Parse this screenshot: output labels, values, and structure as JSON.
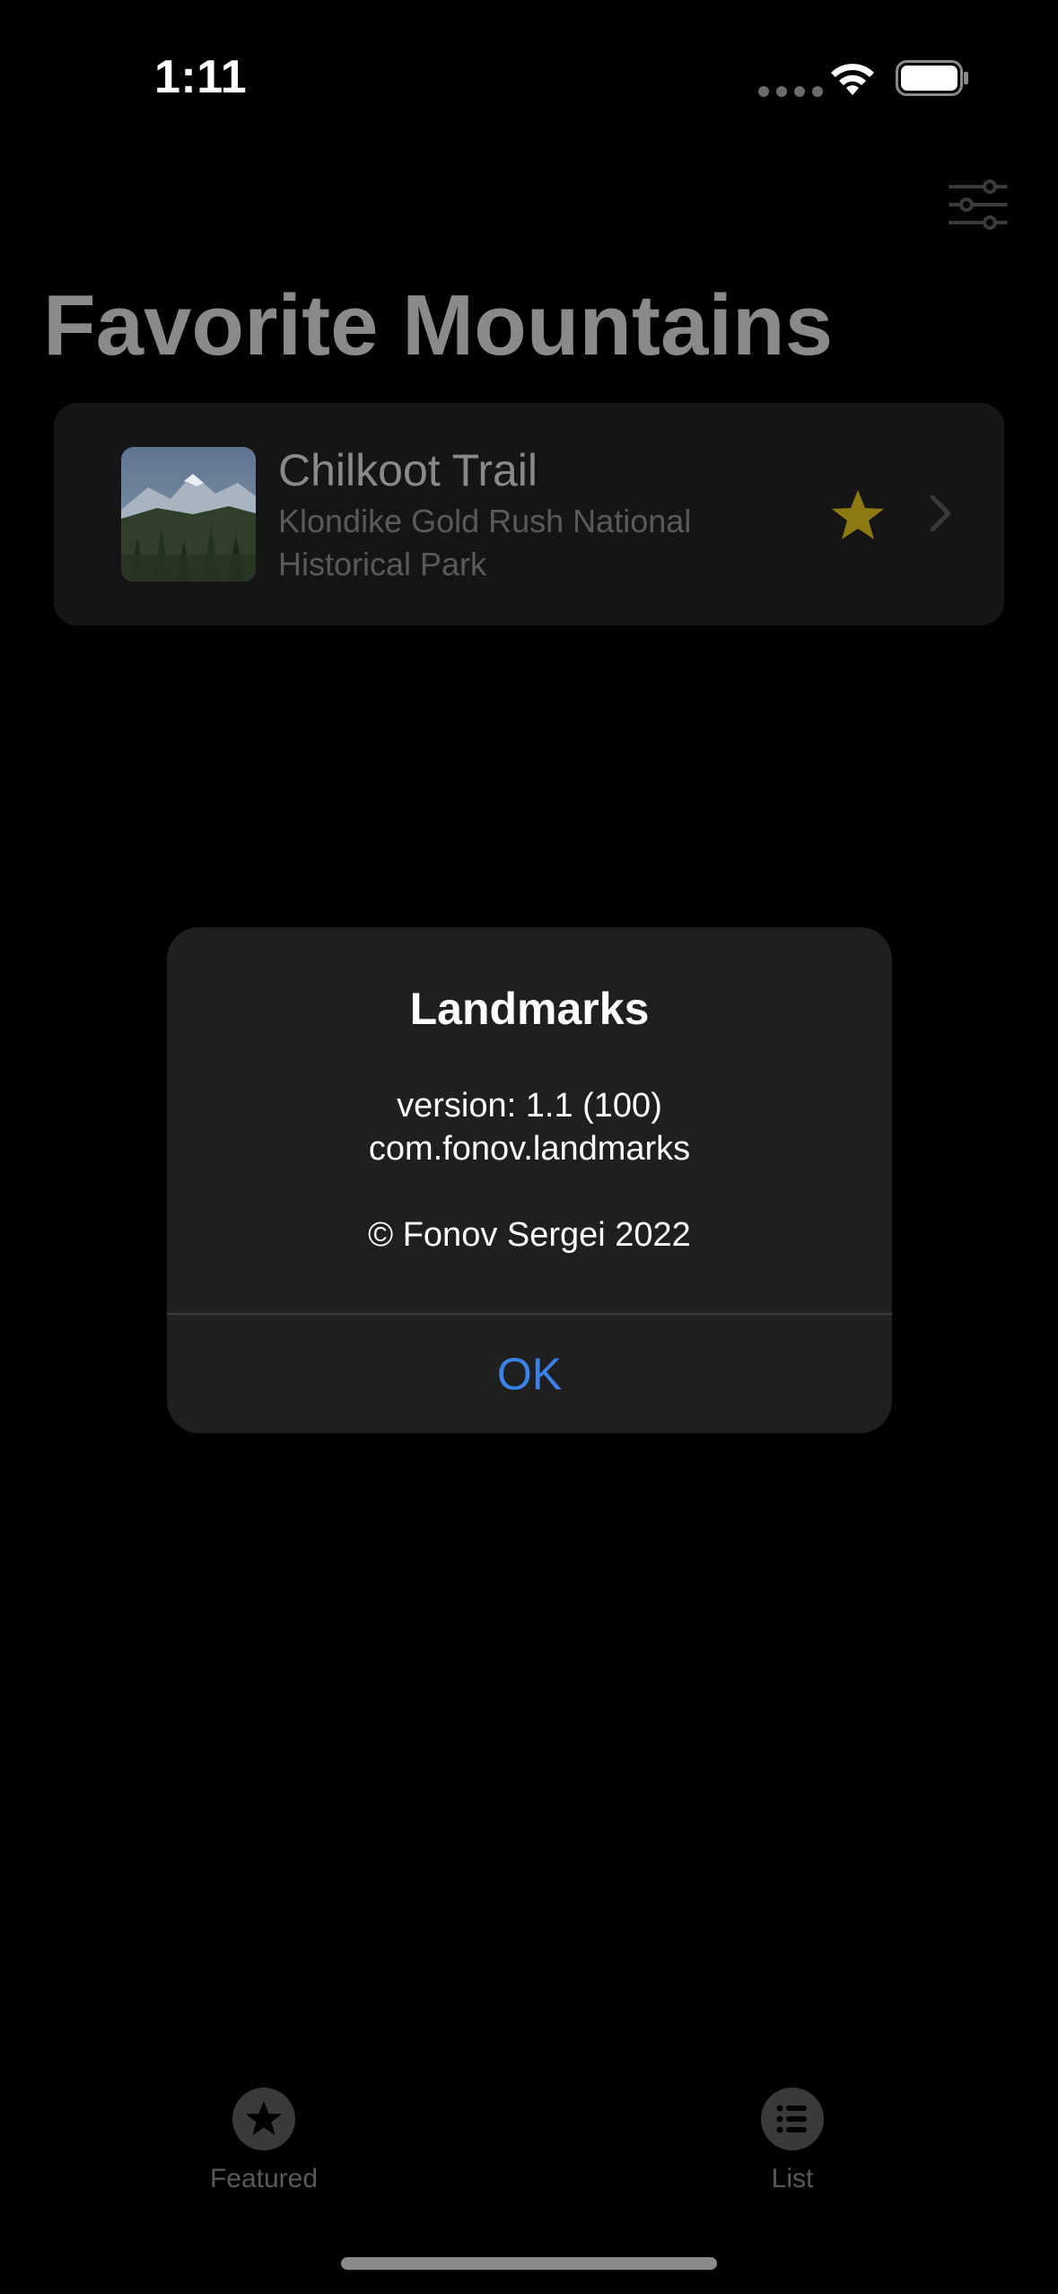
{
  "status_bar": {
    "time": "1:11"
  },
  "header": {
    "title": "Favorite Mountains",
    "filter_icon": "slider-horizontal-icon"
  },
  "landmark_row": {
    "name": "Chilkoot Trail",
    "park": "Klondike Gold Rush National Historical Park",
    "is_favorite": true,
    "star_color": "#8c7a10"
  },
  "alert": {
    "title": "Landmarks",
    "version": "version: 1.1 (100)",
    "bundle_id": "com.fonov.landmarks",
    "copyright": "© Fonov Sergei 2022",
    "ok_label": "OK",
    "accent_color": "#3b82e8"
  },
  "tab_bar": {
    "items": [
      {
        "label": "Featured",
        "icon": "star-circle-icon"
      },
      {
        "label": "List",
        "icon": "list-bullet-circle-icon"
      }
    ]
  }
}
